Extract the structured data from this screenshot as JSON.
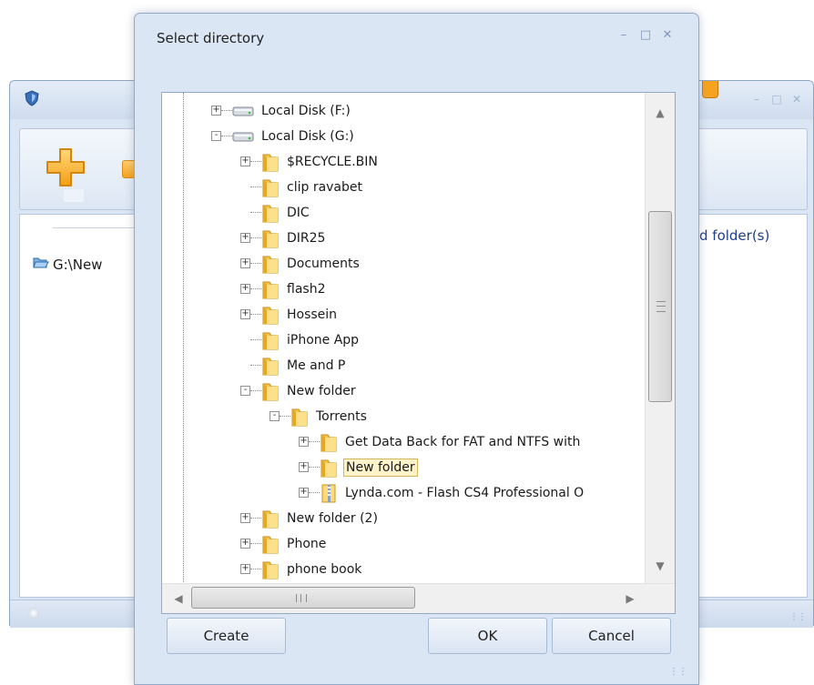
{
  "background_window": {
    "path_text": "G:\\New",
    "folders_label_partial": "d folder(s)",
    "icons": {
      "app": "shield-icon",
      "add": "plus-icon",
      "path_folder": "open-folder-icon"
    },
    "accent_color": "#f6a322"
  },
  "dialog": {
    "title": "Select directory",
    "controls": [
      "minimize",
      "maximize",
      "close"
    ],
    "tree": {
      "items": [
        {
          "label": "Local Disk (F:)",
          "level": 0,
          "icon": "drive-icon",
          "expander": "+"
        },
        {
          "label": "Local Disk (G:)",
          "level": 0,
          "icon": "drive-icon",
          "expander": "-"
        },
        {
          "label": "$RECYCLE.BIN",
          "level": 1,
          "icon": "folder-icon",
          "expander": "+"
        },
        {
          "label": "clip ravabet",
          "level": 1,
          "icon": "folder-icon",
          "expander": ""
        },
        {
          "label": "DIC",
          "level": 1,
          "icon": "folder-icon",
          "expander": ""
        },
        {
          "label": "DIR25",
          "level": 1,
          "icon": "folder-icon",
          "expander": "+"
        },
        {
          "label": "Documents",
          "level": 1,
          "icon": "folder-icon",
          "expander": "+"
        },
        {
          "label": "flash2",
          "level": 1,
          "icon": "folder-icon",
          "expander": "+"
        },
        {
          "label": "Hossein",
          "level": 1,
          "icon": "folder-icon",
          "expander": "+"
        },
        {
          "label": "iPhone App",
          "level": 1,
          "icon": "folder-icon",
          "expander": ""
        },
        {
          "label": "Me and P",
          "level": 1,
          "icon": "folder-icon",
          "expander": ""
        },
        {
          "label": "New folder",
          "level": 1,
          "icon": "folder-icon",
          "expander": "-"
        },
        {
          "label": "Torrents",
          "level": 2,
          "icon": "folder-icon",
          "expander": "-"
        },
        {
          "label": "Get Data Back for FAT and NTFS with",
          "level": 3,
          "icon": "folder-icon",
          "expander": "+"
        },
        {
          "label": "New folder",
          "level": 3,
          "icon": "folder-icon",
          "expander": "+",
          "selected": true
        },
        {
          "label": "Lynda.com - Flash CS4 Professional O",
          "level": 3,
          "icon": "zip-folder-icon",
          "expander": "+"
        },
        {
          "label": "New folder (2)",
          "level": 1,
          "icon": "folder-icon",
          "expander": "+"
        },
        {
          "label": "Phone",
          "level": 1,
          "icon": "folder-icon",
          "expander": "+"
        },
        {
          "label": "phone book",
          "level": 1,
          "icon": "folder-icon",
          "expander": "+"
        }
      ]
    },
    "buttons": {
      "create": "Create",
      "ok": "OK",
      "cancel": "Cancel"
    }
  }
}
